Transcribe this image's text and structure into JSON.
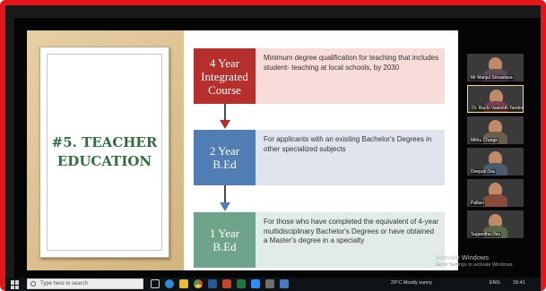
{
  "slide": {
    "title_line1": "#5. Teacher",
    "title_line2": "Education",
    "steps": [
      {
        "box_line1": "4 Year",
        "box_line2": "Integrated",
        "box_line3": "Course",
        "description": "Minimum degree qualification for teaching that includes student- teaching at local schools, by 2030"
      },
      {
        "box_line1": "2 Year",
        "box_line2": "B.Ed",
        "description": "For applicants with an existing Bachelor's Degrees in other specialized subjects"
      },
      {
        "box_line1": "1 Year",
        "box_line2": "B.Ed",
        "description": "For those who have completed the equivalent of 4-year multidisciplinary Bachelor's Degrees or have obtained a Master's degree in a specialty"
      }
    ],
    "colors": {
      "red_box": "#b5302d",
      "blue_box": "#4f7db4",
      "green_box": "#6ea48a",
      "title_green": "#2f6f3e",
      "frame_red": "#e3151a"
    }
  },
  "participants": [
    {
      "name": "Mr Manjul Srivastava",
      "active": false
    },
    {
      "name": "Dr. Ruchi Vasishth Tandon",
      "active": true
    },
    {
      "name": "Mithu Charge",
      "active": false
    },
    {
      "name": "Deepali Das",
      "active": false
    },
    {
      "name": "Pallavi",
      "active": false
    },
    {
      "name": "Sugandha Dey",
      "active": false
    }
  ],
  "watermark": {
    "title": "Activate Windows",
    "subtitle": "Go to Settings to activate Windows."
  },
  "taskbar": {
    "search_placeholder": "Type here to search",
    "weather": "29°C Mostly sunny",
    "language": "ENG",
    "time": "15:41"
  }
}
